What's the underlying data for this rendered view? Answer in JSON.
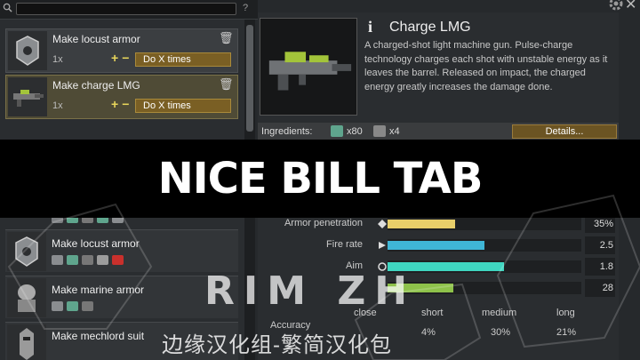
{
  "toolbar": {
    "help_label": "?"
  },
  "bills_top": [
    {
      "title": "Make locust armor",
      "count": "1x",
      "plus": "+",
      "minus": "−",
      "mode": "Do X times"
    },
    {
      "title": "Make charge LMG",
      "count": "1x",
      "plus": "+",
      "minus": "−",
      "mode": "Do X times"
    }
  ],
  "recipes": [
    {
      "title": "Make locust armor"
    },
    {
      "title": "Make marine armor"
    },
    {
      "title": "Make mechlord suit"
    }
  ],
  "detail": {
    "title": "Charge LMG",
    "info_glyph": "i",
    "description": "A charged-shot light machine gun. Pulse-charge technology charges each shot with unstable energy as it leaves the barrel. Released on impact, the charged energy greatly increases the damage done.",
    "ingredients_label": "Ingredients:",
    "ingredients": [
      {
        "count": "x80",
        "icon": "plasteel-icon"
      },
      {
        "count": "x4",
        "icon": "component-icon"
      }
    ],
    "details_button": "Details..."
  },
  "stats": [
    {
      "label": "Armor penetration",
      "value": "35%",
      "fill": 0.35,
      "color": "#e8cf6a"
    },
    {
      "label": "Fire rate",
      "value": "2.5",
      "fill": 0.5,
      "color": "#3fb6d6"
    },
    {
      "label": "Aim",
      "value": "1.8",
      "fill": 0.6,
      "color": "#3fd6c0"
    },
    {
      "label": "",
      "value": "28",
      "fill": 0.34,
      "color": "#8ec24a"
    }
  ],
  "accuracy": {
    "label": "Accuracy",
    "ranges": [
      "close",
      "short",
      "medium",
      "long"
    ],
    "values": [
      "",
      "4%",
      "30%",
      "21%"
    ]
  },
  "banner": {
    "text": "NICE BILL TAB"
  },
  "watermark": {
    "logo": "RIM ZH",
    "subtitle": "边缘汉化组-繁简汉化包"
  }
}
